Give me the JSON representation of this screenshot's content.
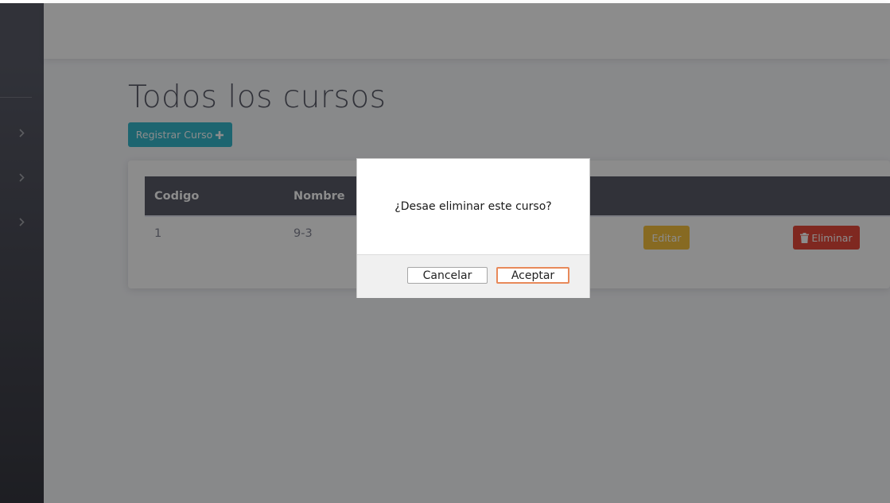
{
  "page": {
    "title": "Todos los cursos",
    "register_button_label": "Registrar Curso"
  },
  "sidebar": {
    "toggles": [
      {
        "icon": "chevron-right-icon"
      },
      {
        "icon": "chevron-right-icon"
      },
      {
        "icon": "chevron-right-icon"
      }
    ]
  },
  "table": {
    "headers": [
      "Codigo",
      "Nombre"
    ],
    "rows": [
      {
        "codigo": "1",
        "nombre": "9-3",
        "edit_label": "Editar",
        "delete_label": "Eliminar"
      }
    ]
  },
  "dialog": {
    "message": "¿Desae eliminar este curso?",
    "cancel_label": "Cancelar",
    "accept_label": "Aceptar"
  },
  "colors": {
    "sidebar": "#5a5c69",
    "info": "#36b9cc",
    "warning": "#f6c23e",
    "danger": "#e74a3b",
    "table_header": "#5a5c69"
  },
  "icons": {
    "register": "plus-icon",
    "delete": "trash-icon"
  }
}
